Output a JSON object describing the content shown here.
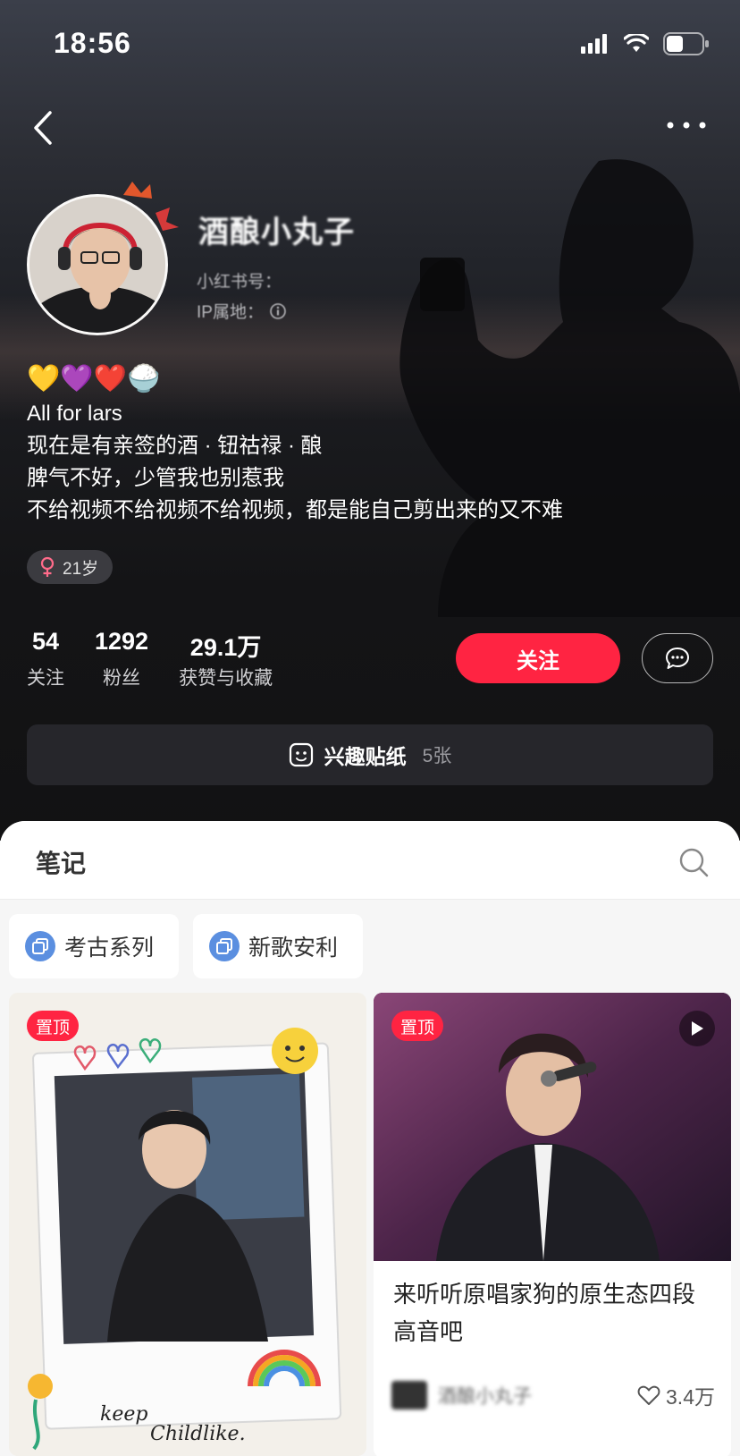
{
  "status_bar": {
    "time": "18:56"
  },
  "profile": {
    "nickname": "酒酿小丸子",
    "red_id": "小红书号：",
    "ip": "IP属地：",
    "emojis": "💛💜❤️🍚",
    "bio": [
      "All for lars",
      "现在是有亲签的酒 · 钮祜禄 · 酿",
      "脾气不好，少管我也别惹我",
      "不给视频不给视频不给视频，都是能自己剪出来的又不难"
    ],
    "age_tag": "21岁",
    "stats": [
      {
        "num": "54",
        "label": "关注"
      },
      {
        "num": "1292",
        "label": "粉丝"
      },
      {
        "num": "29.1万",
        "label": "获赞与收藏"
      }
    ],
    "follow_label": "关注",
    "sticker": {
      "label": "兴趣贴纸",
      "count": "5张"
    }
  },
  "notes": {
    "title": "笔记",
    "collections": [
      {
        "label": "考古系列"
      },
      {
        "label": "新歌安利"
      }
    ],
    "cards": [
      {
        "badge": "置顶",
        "image_text": [
          "keep",
          "Childlike."
        ]
      },
      {
        "badge": "置顶",
        "title": "来听听原唱家狗的原生态四段高音吧",
        "author": "酒酿小丸子",
        "likes": "3.4万"
      }
    ]
  },
  "colors": {
    "accent": "#ff2442",
    "collection_icon": "#5b8fe0"
  }
}
